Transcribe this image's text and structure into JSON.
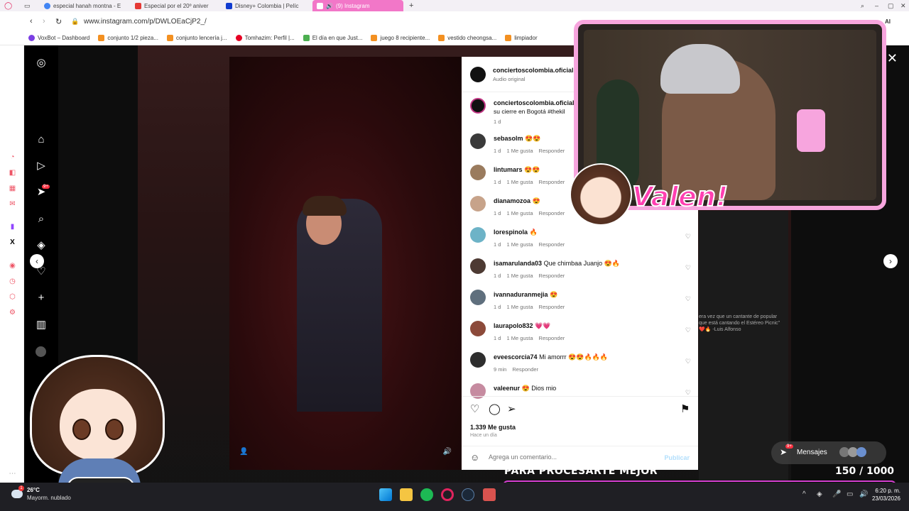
{
  "browser": {
    "tabs": [
      {
        "title": "especial hanah montna - E",
        "color": "#4285f4"
      },
      {
        "title": "Especial por el 20º aniver",
        "color": "#e53935"
      },
      {
        "title": "Disney+ Colombia | Pelíc",
        "color": "#113ccf"
      },
      {
        "title": "(9) Instagram",
        "color": "#e1306c",
        "active": true
      }
    ],
    "new_tab": "+",
    "url": "www.instagram.com/p/DWLOEaCjP2_/",
    "ai_label": "AI",
    "bookmarks": [
      "VoxBot – Dashboard",
      "conjunto 1/2 pieza...",
      "conjunto lencería j...",
      "Tomhazim: Perfil |...",
      "El día en que Just...",
      "juego 8 recipiente...",
      "vestido cheongsa...",
      "limpiador"
    ]
  },
  "instagram": {
    "nav_badge": "9+",
    "post_author": "conciertoscolombia.oficial",
    "audio_label": "Audio original",
    "caption": "su cierre en Bogotá #thekil",
    "caption_time": "1 d",
    "comments": [
      {
        "user": "sebasolm",
        "text": "😍😍",
        "time": "1 d",
        "likes": "1 Me gusta",
        "reply": "Responder",
        "avatar_color": "#3a3a3a"
      },
      {
        "user": "lintumars",
        "text": "😍😍",
        "time": "1 d",
        "likes": "1 Me gusta",
        "reply": "Responder",
        "avatar_color": "#9a7b5e"
      },
      {
        "user": "dianamozoa",
        "text": "😍",
        "time": "1 d",
        "likes": "1 Me gusta",
        "reply": "Responder",
        "avatar_color": "#c7a38a"
      },
      {
        "user": "lorespinola",
        "text": "🔥",
        "time": "1 d",
        "likes": "1 Me gusta",
        "reply": "Responder",
        "avatar_color": "#6db3c7"
      },
      {
        "user": "isamarulanda03",
        "text": "Que chimbaa Juanjo 😍🔥",
        "time": "1 d",
        "likes": "1 Me gusta",
        "reply": "Responder",
        "avatar_color": "#4d3a33"
      },
      {
        "user": "ivannaduranmejia",
        "text": "😍",
        "time": "1 d",
        "likes": "1 Me gusta",
        "reply": "Responder",
        "avatar_color": "#5f6f7d"
      },
      {
        "user": "laurapolo832",
        "text": "💗💗",
        "time": "1 d",
        "likes": "1 Me gusta",
        "reply": "Responder",
        "avatar_color": "#8c4a3a"
      },
      {
        "user": "eveescorcia74",
        "text": "Mi amorrr 😍😍🔥🔥🔥",
        "time": "9 min",
        "likes": "",
        "reply": "Responder",
        "avatar_color": "#2e2e2e"
      },
      {
        "user": "valeenur",
        "text": "😍 Dios mio",
        "time": "",
        "likes": "",
        "reply": "",
        "avatar_color": "#c68ba0"
      }
    ],
    "likes_count": "1.339 Me gusta",
    "posted": "Hace un día",
    "comment_placeholder": "Agrega un comentario...",
    "publish": "Publicar",
    "bg_caption": "era vez que un cantante de popular que está cantando el Estéreo Picnic\" ❤️🔥 -Luis Alfonso"
  },
  "stream": {
    "name_logo": "Valen!",
    "subtitle": "PARA PROCESARTE MEJOR",
    "counter": "150  / 1000",
    "progress_fraction": 0.15,
    "messages_label": "Mensajes",
    "messages_badge": "9+"
  },
  "taskbar": {
    "temp": "26°C",
    "weather": "Mayorm. nublado",
    "weather_badge": "1",
    "time": "6:20 p. m.",
    "date": "23/03/2026"
  }
}
